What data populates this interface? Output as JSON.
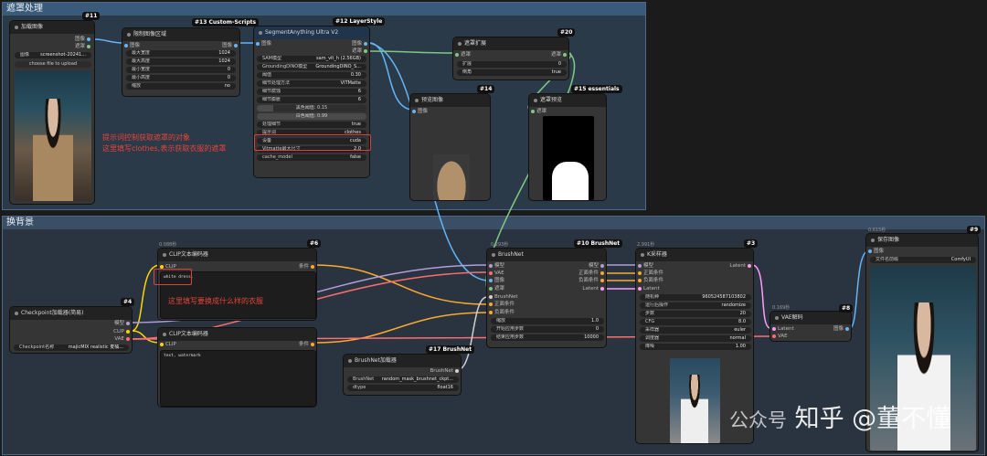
{
  "groups": {
    "top": "遮罩处理",
    "bottom": "换背景"
  },
  "nodes": {
    "load_image": {
      "badge": "#11",
      "title": "加载图像",
      "out1": "图像",
      "out2": "遮罩",
      "image_label": "图像",
      "image_value": "screenshot-20241...",
      "upload": "choose file to upload"
    },
    "limit_size": {
      "badge": "#13 Custom-Scripts",
      "title": "限制图像区域",
      "in": "图像",
      "out": "图像",
      "widgets": [
        {
          "label": "最大宽度",
          "value": "1024"
        },
        {
          "label": "最大高度",
          "value": "1024"
        },
        {
          "label": "最小宽度",
          "value": "0"
        },
        {
          "label": "最小高度",
          "value": "0"
        },
        {
          "label": "缩放",
          "value": "no"
        }
      ]
    },
    "segment": {
      "badge": "#12 LayerStyle",
      "title": "SegmentAnything Ultra V2",
      "in": "图像",
      "out1": "图像",
      "out2": "遮罩",
      "widgets": [
        {
          "label": "SAM模型",
          "value": "sam_vit_h (2.56GB)"
        },
        {
          "label": "GroundingDINO模型",
          "value": "GroundingDINO_S..."
        },
        {
          "label": "阈值",
          "value": "0.30"
        },
        {
          "label": "细节处理方法",
          "value": "VITMatte"
        },
        {
          "label": "细节腐蚀",
          "value": "6"
        },
        {
          "label": "细节膨胀",
          "value": "6"
        }
      ],
      "slider1": "黑色阈值: 0.15",
      "slider2": "白色阈值: 0.99",
      "bool_label": "处理细节",
      "bool_value": "true",
      "prompt_label": "提示词",
      "prompt_value": "clothes",
      "w_device_label": "设备",
      "w_device_value": "cuda",
      "w_vit_label": "Vitmatte最大尺寸",
      "w_vit_value": "2.0",
      "cache_label": "cache_model",
      "cache_value": "false"
    },
    "mask_expand": {
      "badge": "#20",
      "title": "遮罩扩展",
      "in": "遮罩",
      "out": "遮罩",
      "w1_label": "扩展",
      "w1_value": "0",
      "w2_label": "倒角",
      "w2_value": "true"
    },
    "preview": {
      "badge": "#14",
      "title": "预览图像",
      "in": "图像"
    },
    "mask_preview": {
      "badge": "#15 essentials",
      "title": "遮罩预览",
      "in": "遮罩"
    },
    "clip_pos": {
      "badge": "#6",
      "timing": "0.088秒",
      "title": "CLIP文本编码器",
      "in": "CLIP",
      "out": "条件",
      "text": "white dress,"
    },
    "clip_neg": {
      "badge": "#7",
      "timing": "0.072秒",
      "title": "CLIP文本编码器",
      "in": "CLIP",
      "out": "条件",
      "text": "text, watermark"
    },
    "checkpoint": {
      "badge": "#4",
      "title": "Checkpoint加载器(简易)",
      "out1": "模型",
      "out2": "CLIP",
      "out3": "VAE",
      "w_label": "Checkpoint名称",
      "w_value": "majicMIX realistic 麦橘..."
    },
    "brushnet_loader": {
      "badge": "#17 BrushNet",
      "title": "BrushNet加载器",
      "out": "BrushNet",
      "w1_label": "BrushNet",
      "w1_value": "random_mask_brushnet_ckpt...",
      "w2_label": "dtype",
      "w2_value": "float16"
    },
    "brushnet": {
      "badge": "#10 BrushNet",
      "timing": "0.293秒",
      "title": "BrushNet",
      "ins": [
        "模型",
        "VAE",
        "图像",
        "遮罩",
        "BrushNet",
        "正面条件",
        "负面条件"
      ],
      "outs": [
        "模型",
        "正面条件",
        "负面条件",
        "Latent"
      ],
      "widgets": [
        {
          "label": "缩放",
          "value": "1.0"
        },
        {
          "label": "开始应用步数",
          "value": "0"
        },
        {
          "label": "结束应用步数",
          "value": "10000"
        }
      ]
    },
    "ksampler": {
      "badge": "#3",
      "timing": "2.991秒",
      "title": "K采样器",
      "ins": [
        "模型",
        "正面条件",
        "负面条件",
        "Latent"
      ],
      "out": "Latent",
      "widgets": [
        {
          "label": "随机种",
          "value": "960524587103802"
        },
        {
          "label": "运行后操作",
          "value": "randomize"
        },
        {
          "label": "步数",
          "value": "20"
        },
        {
          "label": "CFG",
          "value": "8.0"
        },
        {
          "label": "采样器",
          "value": "euler"
        },
        {
          "label": "调度器",
          "value": "normal"
        },
        {
          "label": "降噪",
          "value": "1.00"
        }
      ]
    },
    "vae_decode": {
      "badge": "#8",
      "timing": "0.169秒",
      "title": "VAE解码",
      "in1": "Latent",
      "in2": "VAE",
      "out": "图像"
    },
    "save_image": {
      "badge": "#9",
      "timing": "0.615秒",
      "title": "保存图像",
      "in": "图像",
      "w_label": "文件名前缀",
      "w_value": "ComfyUI"
    }
  },
  "annotations": {
    "note1_line1": "提示词控制获取遮罩的对象",
    "note1_line2": "这里填写clothes,表示获取衣服的遮罩",
    "note2": "这里填写要换成什么样的衣服"
  },
  "watermark": "知乎 @董不懂",
  "watermark_prefix": "公众号",
  "colors": {
    "image_link": "#64b5f6",
    "mask_link": "#81c784",
    "clip_link": "#ffd500",
    "cond_link": "#ffa931",
    "model_link": "#b39ddb",
    "latent_link": "#ff9cf9",
    "vae_link": "#ff6e6e",
    "annotation_red": "#e0403a"
  }
}
